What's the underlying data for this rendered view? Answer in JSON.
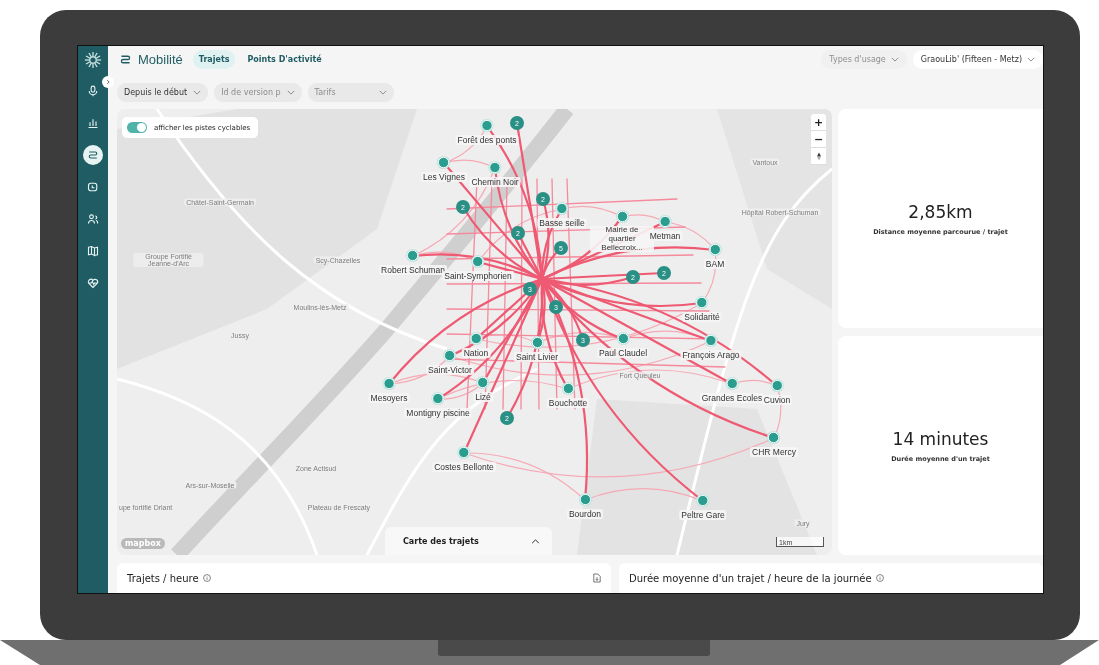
{
  "sidebar": {
    "items": [
      {
        "selected": false
      },
      {
        "selected": false
      },
      {
        "selected": true
      },
      {
        "selected": false
      },
      {
        "selected": false
      },
      {
        "selected": false
      },
      {
        "selected": false
      }
    ]
  },
  "header": {
    "title": "Mobilité",
    "tabs": [
      {
        "label": "Trajets",
        "selected": true
      },
      {
        "label": "Points D'activité",
        "selected": false
      }
    ],
    "selectors": [
      {
        "label": "Types d'usage",
        "disabled": true
      },
      {
        "label": "GraouLib' (Fifteen - Metz)",
        "disabled": false
      }
    ]
  },
  "filters": [
    {
      "label": "Depuis le début",
      "disabled": false
    },
    {
      "label": "Id de version p",
      "disabled": true
    },
    {
      "label": "Tarifs",
      "disabled": true
    }
  ],
  "map": {
    "toggle": {
      "label": "afficher les pistes cyclables",
      "on": true
    },
    "zoom_in": "+",
    "zoom_out": "−",
    "stations": [
      {
        "name": "Forêt des ponts"
      },
      {
        "name": "Les Vignes"
      },
      {
        "name": "Chemin Noir"
      },
      {
        "name": "Robert Schuman"
      },
      {
        "name": "Saint-Symphorien"
      },
      {
        "name": "Basse seille"
      },
      {
        "name": "Mairie de quartier Bellecroix..."
      },
      {
        "name": "Metman"
      },
      {
        "name": "BAM"
      },
      {
        "name": "Solidarité"
      },
      {
        "name": "Nation"
      },
      {
        "name": "Saint Livier"
      },
      {
        "name": "Paul Claudel"
      },
      {
        "name": "François Arago"
      },
      {
        "name": "Saint-Victor"
      },
      {
        "name": "Mesoyers"
      },
      {
        "name": "Lizé"
      },
      {
        "name": "Montigny piscine"
      },
      {
        "name": "Bouchotte"
      },
      {
        "name": "Grandes Ecoles"
      },
      {
        "name": "Cuvion"
      },
      {
        "name": "CHR Mercy"
      },
      {
        "name": "Costes Bellonte"
      },
      {
        "name": "Bourdon"
      },
      {
        "name": "Peltre Gare"
      }
    ],
    "clusters": [
      {
        "count": "2"
      },
      {
        "count": "2"
      },
      {
        "count": "2"
      },
      {
        "count": "2"
      },
      {
        "count": "5"
      },
      {
        "count": "3"
      },
      {
        "count": "3"
      },
      {
        "count": "3"
      },
      {
        "count": "2"
      },
      {
        "count": "2"
      },
      {
        "count": "2"
      }
    ],
    "places": [
      {
        "name": "Châtel-Saint-Germain"
      },
      {
        "name": "Groupe Fortifié Jeanne-d'Arc"
      },
      {
        "name": "Scy-Chazelles"
      },
      {
        "name": "Moulins-lès-Metz"
      },
      {
        "name": "Jussy"
      },
      {
        "name": "Vantoux"
      },
      {
        "name": "Hôpital Robert-Schuman"
      },
      {
        "name": "Fort Queuleu"
      },
      {
        "name": "Ars-sur-Moselle"
      },
      {
        "name": "Zone Actisud"
      },
      {
        "name": "Plateau de Frescaty"
      },
      {
        "name": "Jury"
      },
      {
        "name": "upe fortifié Driant"
      }
    ],
    "attribution": "mapbox",
    "scale": "1km",
    "panel_title": "Carte des trajets"
  },
  "stats": [
    {
      "value": "2,85km",
      "label": "Distance moyenne parcourue / trajet"
    },
    {
      "value": "14 minutes",
      "label": "Durée moyenne d'un trajet"
    }
  ],
  "bottom_cards": [
    {
      "title": "Trajets / heure",
      "download": true
    },
    {
      "title": "Durée moyenne d'un trajet / heure de la journée",
      "download": false
    }
  ]
}
